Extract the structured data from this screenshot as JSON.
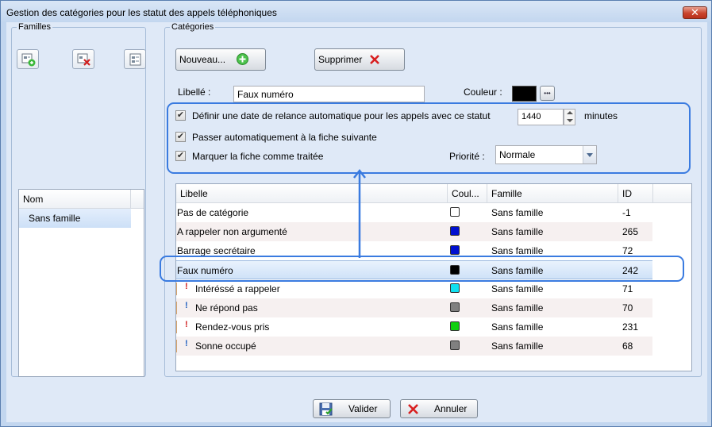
{
  "window": {
    "title": "Gestion des catégories pour les statut des appels téléphoniques",
    "close_label": "✕"
  },
  "familles": {
    "group_label": "Familles",
    "column_header": "Nom",
    "items": [
      "Sans famille"
    ]
  },
  "categories": {
    "group_label": "Catégories",
    "new_button": "Nouveau...",
    "delete_button": "Supprimer",
    "libelle_label": "Libellé :",
    "libelle_value": "Faux numéro",
    "couleur_label": "Couleur :",
    "couleur_value": "#000000",
    "couleur_button": "•••",
    "relance_label": "Définir une date de relance automatique pour les appels avec ce statut",
    "relance_value": "1440",
    "relance_unit": "minutes",
    "fiche_suivante_label": "Passer automatiquement à la fiche suivante",
    "traitee_label": "Marquer la fiche comme traitée",
    "priorite_label": "Priorité :",
    "priorite_value": "Normale",
    "checked": true
  },
  "table": {
    "headers": {
      "libelle": "Libelle",
      "couleur": "Coul...",
      "famille": "Famille",
      "id": "ID"
    },
    "rows": [
      {
        "libelle": "Pas de catégorie",
        "color": "#ffffff",
        "famille": "Sans famille",
        "id": "-1",
        "child": false,
        "mark": ""
      },
      {
        "libelle": "A rappeler non argumenté",
        "color": "#0010d0",
        "famille": "Sans famille",
        "id": "265",
        "child": false,
        "mark": ""
      },
      {
        "libelle": "Barrage secrétaire",
        "color": "#0010d0",
        "famille": "Sans famille",
        "id": "72",
        "child": false,
        "mark": ""
      },
      {
        "libelle": "Faux numéro",
        "color": "#000000",
        "famille": "Sans famille",
        "id": "242",
        "child": false,
        "mark": "",
        "selected": true
      },
      {
        "libelle": "Intéréssé a rappeler",
        "color": "#10e0f0",
        "famille": "Sans famille",
        "id": "71",
        "child": true,
        "mark": "!",
        "mark_color": "#d02020"
      },
      {
        "libelle": "Ne répond pas",
        "color": "#808080",
        "famille": "Sans famille",
        "id": "70",
        "child": true,
        "mark": "!",
        "mark_color": "#2060c0"
      },
      {
        "libelle": "Rendez-vous pris",
        "color": "#10d010",
        "famille": "Sans famille",
        "id": "231",
        "child": true,
        "mark": "!",
        "mark_color": "#d02020"
      },
      {
        "libelle": "Sonne occupé",
        "color": "#808080",
        "famille": "Sans famille",
        "id": "68",
        "child": true,
        "mark": "!",
        "mark_color": "#2060c0"
      }
    ]
  },
  "footer": {
    "ok_button": "Valider",
    "cancel_button": "Annuler"
  },
  "colors": {
    "highlight": "#3a7be0",
    "accent": "#c2d6ef"
  }
}
